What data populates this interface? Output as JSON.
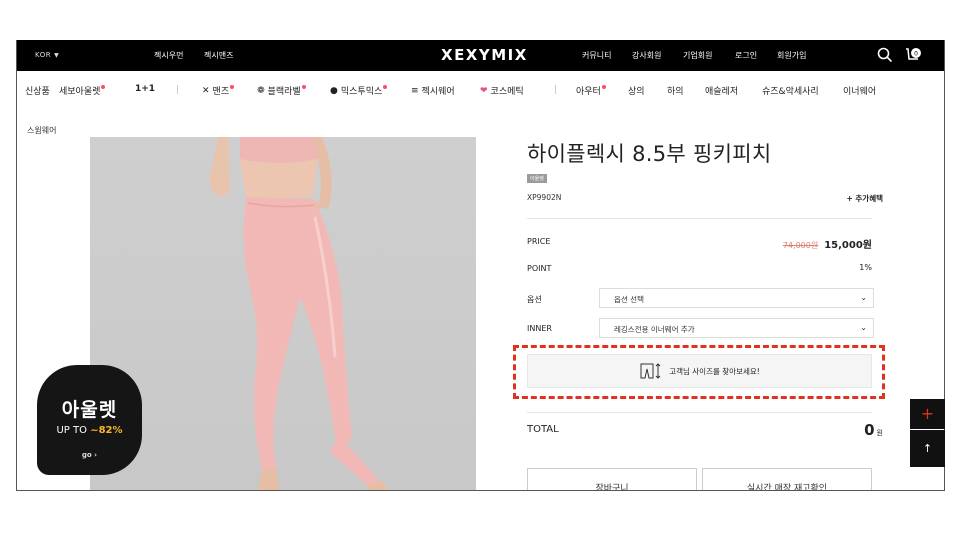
{
  "header": {
    "language": "KOR",
    "segments": [
      "젝시우먼",
      "젝시맨즈"
    ],
    "logo": "XEXYMIX",
    "utility_links": [
      "커뮤니티",
      "강사회원",
      "기업회원",
      "로그인",
      "회원가입"
    ],
    "icons": [
      "search-icon",
      "cart-icon"
    ]
  },
  "category_nav": {
    "items": [
      {
        "label": "신상품",
        "glyph": ""
      },
      {
        "label": "세보아울렛",
        "glyph": "",
        "dot": true
      },
      {
        "label": "1+1",
        "glyph": ""
      },
      {
        "label": "맨즈",
        "glyph": "✕",
        "dot": true
      },
      {
        "label": "블랙라벨",
        "glyph": "❁",
        "dot": true
      },
      {
        "label": "믹스투믹스",
        "glyph": "●",
        "dot": true
      },
      {
        "label": "젝시웨어",
        "glyph": "≡"
      },
      {
        "label": "코스메틱",
        "glyph": "❤"
      },
      {
        "label": "아우터",
        "dot": true
      },
      {
        "label": "상의"
      },
      {
        "label": "하의"
      },
      {
        "label": "애슬레저"
      },
      {
        "label": "슈즈&악세사리"
      },
      {
        "label": "이너웨어"
      }
    ]
  },
  "breadcrumb": "스윔웨어",
  "outlet_banner": {
    "title": "아울렛",
    "up_to_prefix": "UP TO",
    "discount": "~82%",
    "go": "go ›"
  },
  "product": {
    "title": "하이플렉시 8.5부 핑키피치",
    "tag": "아울렛",
    "code": "XP9902N",
    "extra_benefit": "+ 추가혜택",
    "price_label": "PRICE",
    "price_original": "74,000원",
    "price_sale": "15,000원",
    "point_label": "POINT",
    "point_value": "1%",
    "option_label": "옵션",
    "option_placeholder": "옵션 선택",
    "inner_label": "INNER",
    "inner_placeholder": "레깅스전용 이너웨어 추가",
    "size_finder": "고객님 사이즈를 찾아보세요!",
    "total_label": "TOTAL",
    "total_value": "0",
    "total_unit": "원",
    "cart_button": "장바구니",
    "stock_button": "실시간 매장 재고확인"
  },
  "float_buttons": {
    "plus": "+",
    "up": "↑"
  },
  "colors": {
    "topbar": "#000000",
    "accent_dot": "#ff4a6a",
    "highlight_border": "#e0321e",
    "strike_price": "#e07c76",
    "outlet_discount": "#f6b92f",
    "legging": "#f2b8b5"
  }
}
